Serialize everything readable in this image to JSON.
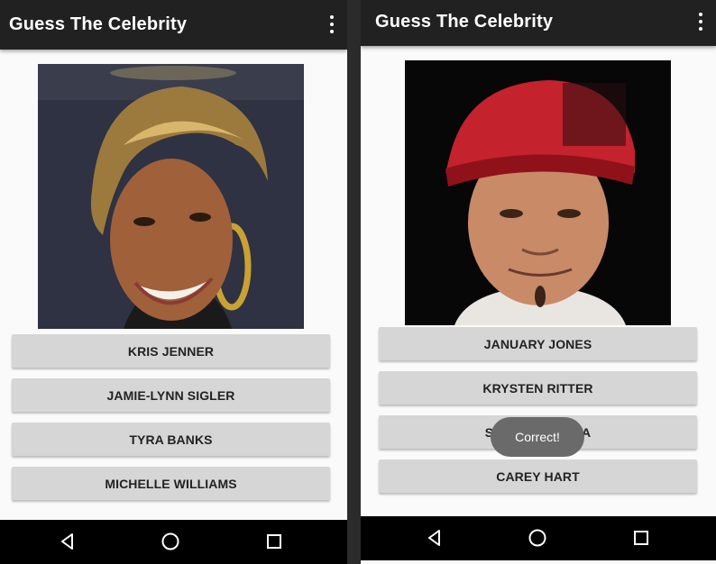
{
  "left": {
    "app_title": "Guess The Celebrity",
    "menu_icon": "more-vert-icon",
    "answers": [
      "KRIS JENNER",
      "JAMIE-LYNN SIGLER",
      "TYRA BANKS",
      "MICHELLE WILLIAMS"
    ]
  },
  "right": {
    "app_title": "Guess The Celebrity",
    "menu_icon": "more-vert-icon",
    "answers": [
      "JANUARY JONES",
      "KRYSTEN RITTER",
      "SOFIA VERGARA",
      "CAREY HART"
    ],
    "toast": "Correct!"
  },
  "navbar": {
    "icons": [
      "back-icon",
      "home-icon",
      "recents-icon"
    ]
  },
  "colors": {
    "appbar": "#212121",
    "button": "#d6d6d6",
    "background": "#fafafa",
    "navbar": "#000000",
    "toast": "#6a6a6a"
  }
}
